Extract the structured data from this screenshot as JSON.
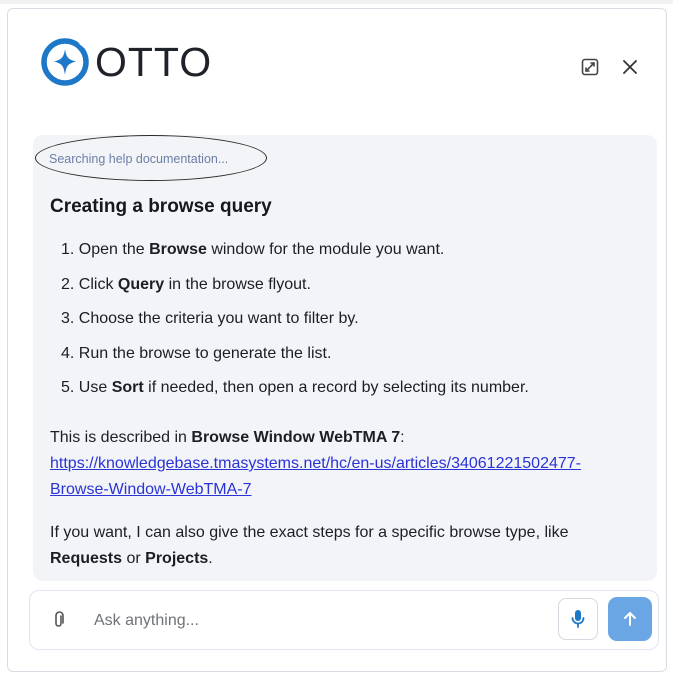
{
  "app": {
    "name": "OTTO",
    "accent_color": "#1e78c8",
    "icons": {
      "logo": "sparkle-ring-icon",
      "expand": "expand-icon",
      "close": "close-icon",
      "attach": "paperclip-icon",
      "mic": "microphone-icon",
      "send": "arrow-up-icon"
    }
  },
  "message": {
    "status": "Searching help documentation...",
    "title": "Creating a browse query",
    "steps": [
      {
        "num": "1.",
        "pre": "Open the ",
        "bold": "Browse",
        "post": " window for the module you want."
      },
      {
        "num": "2.",
        "pre": "Click ",
        "bold": "Query",
        "post": " in the browse flyout."
      },
      {
        "num": "3.",
        "pre": "Choose the criteria you want to filter by.",
        "bold": "",
        "post": ""
      },
      {
        "num": "4.",
        "pre": "Run the browse to generate the list.",
        "bold": "",
        "post": ""
      },
      {
        "num": "5.",
        "pre": "Use ",
        "bold": "Sort",
        "post": " if needed, then open a record by selecting its number."
      }
    ],
    "source_pre": "This is described in ",
    "source_bold": "Browse Window WebTMA 7",
    "source_post": ":",
    "link_line1": "https://knowledgebase.tmasystems.net/hc/en-us/articles/34061221502477-",
    "link_line2": "Browse-Window-WebTMA-7",
    "offer_pre": "If you want, I can also give the exact steps for a specific browse type, like",
    "offer_bold1": "Requests",
    "offer_mid": " or ",
    "offer_bold2": "Projects",
    "offer_post": "."
  },
  "input": {
    "placeholder": "Ask anything..."
  }
}
